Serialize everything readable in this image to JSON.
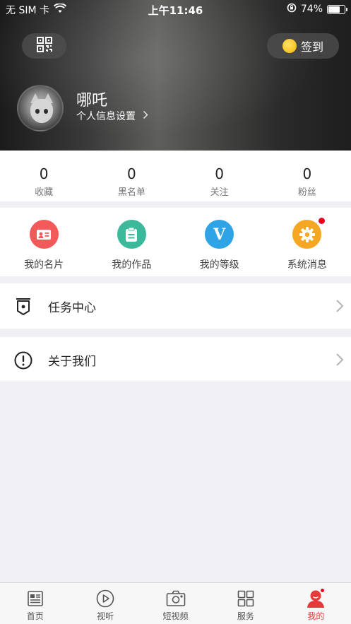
{
  "status_bar": {
    "carrier": "无 SIM 卡",
    "time": "上午11:46",
    "battery": "74%",
    "battery_level": 0.74
  },
  "header": {
    "signin_label": "签到",
    "username": "哪吒",
    "profile_link": "个人信息设置"
  },
  "stats": [
    {
      "value": "0",
      "label": "收藏"
    },
    {
      "value": "0",
      "label": "黑名单"
    },
    {
      "value": "0",
      "label": "关注"
    },
    {
      "value": "0",
      "label": "粉丝"
    }
  ],
  "actions": [
    {
      "label": "我的名片",
      "icon": "id-card-icon",
      "color": "#f25a5a"
    },
    {
      "label": "我的作品",
      "icon": "clipboard-icon",
      "color": "#3cb99a"
    },
    {
      "label": "我的等级",
      "icon": "v-level-icon",
      "color": "#2ea3e6"
    },
    {
      "label": "系统消息",
      "icon": "gear-icon",
      "color": "#f5a623",
      "has_badge": true
    }
  ],
  "rows": {
    "task_center": "任务中心",
    "about_us": "关于我们"
  },
  "tabbar": [
    {
      "label": "首页",
      "icon": "newspaper-icon"
    },
    {
      "label": "视听",
      "icon": "play-circle-icon"
    },
    {
      "label": "短视频",
      "icon": "camera-icon"
    },
    {
      "label": "服务",
      "icon": "grid-icon"
    },
    {
      "label": "我的",
      "icon": "person-icon",
      "active": true
    }
  ],
  "colors": {
    "accent": "#e63a3a",
    "badge": "#e6001b"
  }
}
